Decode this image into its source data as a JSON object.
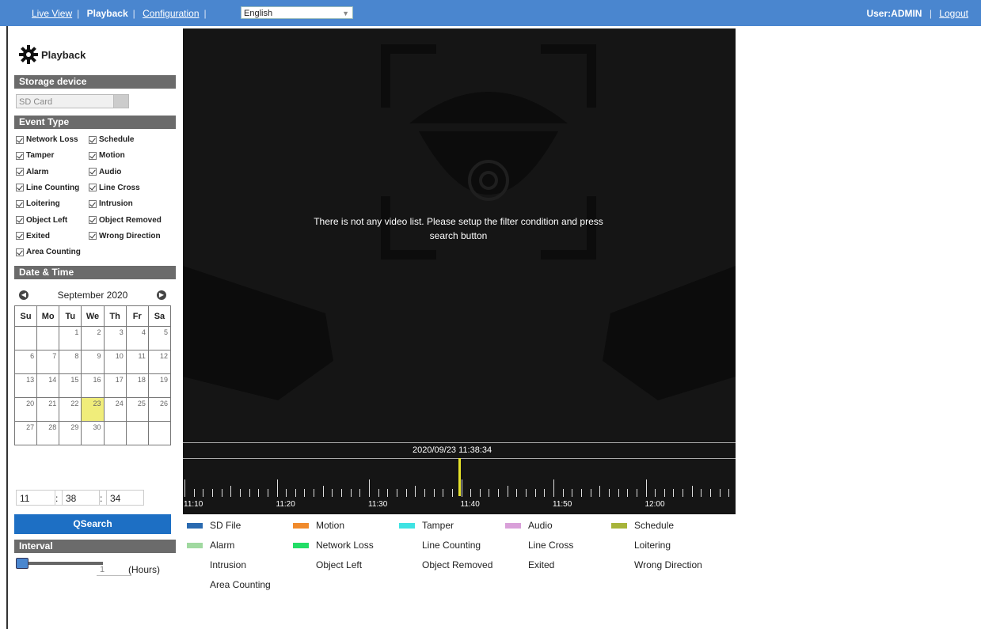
{
  "topbar": {
    "nav": [
      {
        "label": "Live View",
        "active": false
      },
      {
        "label": "Playback",
        "active": true
      },
      {
        "label": "Configuration",
        "active": false
      }
    ],
    "language": "English",
    "user": "User:ADMIN",
    "logout": "Logout"
  },
  "sidebar": {
    "title": "Playback",
    "storage": {
      "heading": "Storage device",
      "value": "SD Card"
    },
    "event_type": {
      "heading": "Event Type",
      "items": [
        "Network Loss",
        "Schedule",
        "Tamper",
        "Motion",
        "Alarm",
        "Audio",
        "Line Counting",
        "Line Cross",
        "Loitering",
        "Intrusion",
        "Object Left",
        "Object Removed",
        "Exited",
        "Wrong Direction",
        "Area Counting"
      ]
    },
    "datetime": {
      "heading": "Date & Time",
      "month_label": "September 2020",
      "weekdays": [
        "Su",
        "Mo",
        "Tu",
        "We",
        "Th",
        "Fr",
        "Sa"
      ],
      "weeks": [
        [
          "",
          "",
          "1",
          "2",
          "3",
          "4",
          "5"
        ],
        [
          "6",
          "7",
          "8",
          "9",
          "10",
          "11",
          "12"
        ],
        [
          "13",
          "14",
          "15",
          "16",
          "17",
          "18",
          "19"
        ],
        [
          "20",
          "21",
          "22",
          "23",
          "24",
          "25",
          "26"
        ],
        [
          "27",
          "28",
          "29",
          "30",
          "",
          "",
          ""
        ]
      ],
      "selected_day": "23",
      "hour": "11",
      "minute": "38",
      "second": "34"
    },
    "search_label": "QSearch",
    "interval": {
      "heading": "Interval",
      "value": "1",
      "unit": "(Hours)"
    }
  },
  "video": {
    "message_line1": "There is not any video list. Please setup the filter condition and press",
    "message_line2": "search button",
    "timestamp": "2020/09/23 11:38:34",
    "time_labels": [
      "11:10",
      "11:20",
      "11:30",
      "11:40",
      "11:50",
      "12:00"
    ]
  },
  "legend": [
    {
      "label": "SD File",
      "color": "#2a6ab0"
    },
    {
      "label": "Motion",
      "color": "#f08a2c"
    },
    {
      "label": "Tamper",
      "color": "#3fe3e3"
    },
    {
      "label": "Audio",
      "color": "#d9a0d9"
    },
    {
      "label": "Schedule",
      "color": "#a7b43a"
    },
    {
      "label": "Alarm",
      "color": "#a0d9a0"
    },
    {
      "label": "Network Loss",
      "color": "#22dd66"
    },
    {
      "label": "Line Counting",
      "color": ""
    },
    {
      "label": "Line Cross",
      "color": ""
    },
    {
      "label": "Loitering",
      "color": ""
    },
    {
      "label": "Intrusion",
      "color": ""
    },
    {
      "label": "Object Left",
      "color": ""
    },
    {
      "label": "Object Removed",
      "color": ""
    },
    {
      "label": "Exited",
      "color": ""
    },
    {
      "label": "Wrong Direction",
      "color": ""
    },
    {
      "label": "Area Counting",
      "color": ""
    }
  ]
}
